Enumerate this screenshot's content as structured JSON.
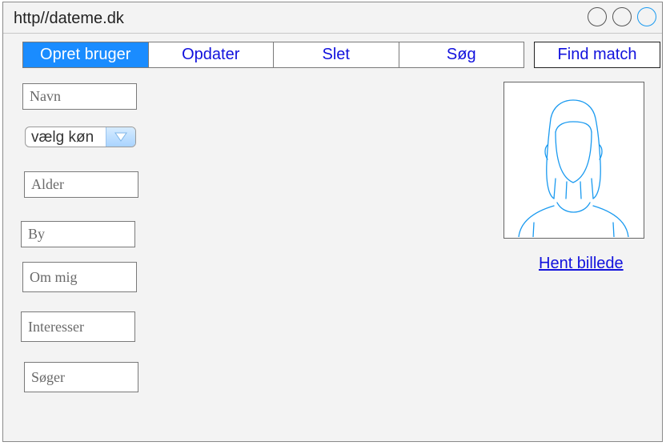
{
  "window": {
    "url": "http//dateme.dk"
  },
  "tabs": [
    {
      "label": "Opret bruger"
    },
    {
      "label": "Opdater"
    },
    {
      "label": "Slet"
    },
    {
      "label": "Søg"
    }
  ],
  "find_match": {
    "label": "Find match"
  },
  "form": {
    "navn": {
      "placeholder": "Navn"
    },
    "gender_select": {
      "value": "vælg køn"
    },
    "alder": {
      "placeholder": "Alder"
    },
    "by": {
      "placeholder": "By"
    },
    "om_mig": {
      "placeholder": "Om mig"
    },
    "interesser": {
      "placeholder": "Interesser"
    },
    "soger": {
      "placeholder": "Søger"
    }
  },
  "photo": {
    "icon": "person-silhouette-icon",
    "link_label": "Hent billede"
  },
  "colors": {
    "accent": "#1a8cff",
    "link": "#1111dd",
    "icon_stroke": "#1a9af0"
  }
}
